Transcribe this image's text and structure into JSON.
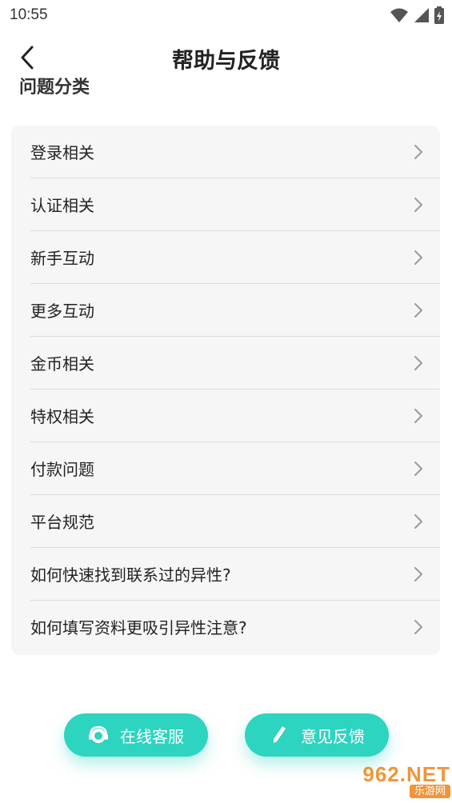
{
  "status_bar": {
    "time": "10:55",
    "icons": [
      "wifi-icon",
      "signal-icon",
      "battery-icon"
    ]
  },
  "header": {
    "title": "帮助与反馈",
    "back_icon": "chevron-left-icon"
  },
  "section": {
    "title": "问题分类"
  },
  "categories": [
    {
      "label": "登录相关"
    },
    {
      "label": "认证相关"
    },
    {
      "label": "新手互动"
    },
    {
      "label": "更多互动"
    },
    {
      "label": "金币相关"
    },
    {
      "label": "特权相关"
    },
    {
      "label": "付款问题"
    },
    {
      "label": "平台规范"
    },
    {
      "label": "如何快速找到联系过的异性?"
    },
    {
      "label": "如何填写资料更吸引异性注意?"
    }
  ],
  "actions": {
    "online_service": {
      "label": "在线客服",
      "icon": "headset-icon"
    },
    "feedback": {
      "label": "意见反馈",
      "icon": "pencil-icon"
    }
  },
  "watermark": {
    "main": "962.NET",
    "sub": "乐游网"
  },
  "colors": {
    "accent": "#2dd4c0",
    "card_bg": "#f6f6f6",
    "divider": "#dcdcdc",
    "chevron": "#9a9a9a"
  }
}
